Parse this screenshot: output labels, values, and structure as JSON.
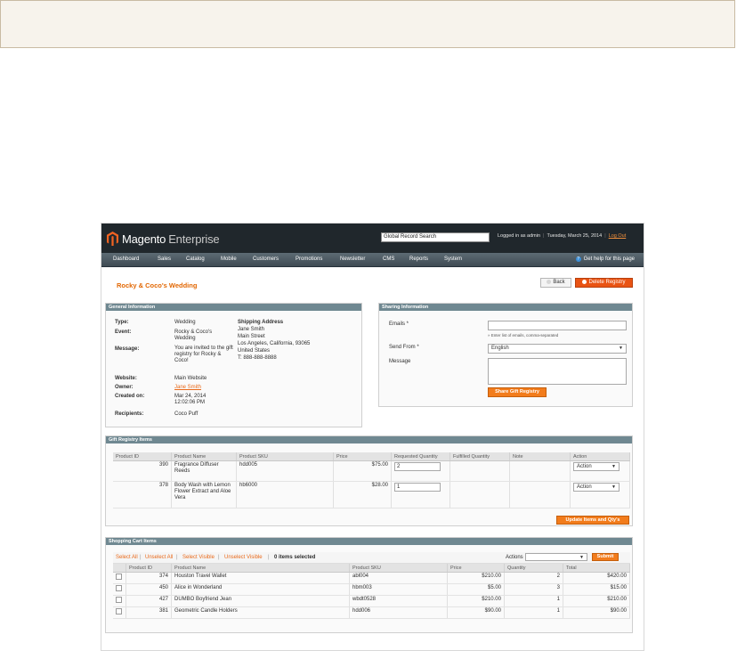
{
  "header": {
    "logo_word": "Magento",
    "logo_edition": "Enterprise",
    "global_search": "Global Record Search",
    "logged_in": "Logged in as admin",
    "date": "Tuesday, March 25, 2014",
    "logout": "Log Out"
  },
  "nav": {
    "items": [
      "Dashboard",
      "Sales",
      "Catalog",
      "Mobile",
      "Customers",
      "Promotions",
      "Newsletter",
      "CMS",
      "Reports",
      "System"
    ],
    "help": "Get help for this page"
  },
  "page": {
    "title": "Rocky & Coco's Wedding",
    "back": "Back",
    "delete": "Delete Registry"
  },
  "general": {
    "heading": "General Information",
    "type_label": "Type:",
    "type": "Wedding",
    "event_label": "Event:",
    "event": "Rocky & Coco's Wedding",
    "message_label": "Message:",
    "message": "You are invited to the gift registry for Rocky & Coco!",
    "website_label": "Website:",
    "website": "Main Website",
    "owner_label": "Owner:",
    "owner": "Jane Smith",
    "created_label": "Created on:",
    "created": "Mar 24, 2014 12:02:06 PM",
    "recipients_label": "Recipients:",
    "recipients": "Coco Puff",
    "shipping_heading": "Shipping Address",
    "shipping_lines": [
      "Jane Smith",
      "Main Street",
      "Los Angeles, California, 93065",
      "United States",
      "T: 888-888-8888"
    ]
  },
  "sharing": {
    "heading": "Sharing Information",
    "emails_label": "Emails *",
    "emails_hint": "Enter list of emails, comma-separated",
    "send_from_label": "Send From *",
    "send_from": "English",
    "message_label": "Message",
    "share_button": "Share Gift Registry"
  },
  "registry_items": {
    "heading": "Gift Registry Items",
    "columns": [
      "Product ID",
      "Product Name",
      "Product SKU",
      "Price",
      "Requested Quantity",
      "Fulfilled Quantity",
      "Note",
      "Action"
    ],
    "rows": [
      {
        "id": "390",
        "name": "Fragrance Diffuser Reeds",
        "sku": "hdd005",
        "price": "$75.00",
        "qty": "2",
        "fulfilled": "",
        "note": "",
        "action": "Action"
      },
      {
        "id": "378",
        "name": "Body Wash with Lemon Flower Extract and Aloe Vera",
        "sku": "hb6000",
        "price": "$28.00",
        "qty": "1",
        "fulfilled": "",
        "note": "",
        "action": "Action"
      }
    ],
    "update_button": "Update Items and Qty's"
  },
  "cart_items": {
    "heading": "Shopping Cart Items",
    "select_all": "Select All",
    "unselect_all": "Unselect All",
    "select_visible": "Select Visible",
    "unselect_visible": "Unselect Visible",
    "selected_count": "0 items selected",
    "actions_label": "Actions",
    "submit": "Submit",
    "columns": [
      "Product ID",
      "Product Name",
      "Product SKU",
      "Price",
      "Quantity",
      "Total"
    ],
    "rows": [
      {
        "id": "374",
        "name": "Houston Travel Wallet",
        "sku": "abl004",
        "price": "$210.00",
        "qty": "2",
        "total": "$420.00"
      },
      {
        "id": "450",
        "name": "Alice in Wonderland",
        "sku": "hbm003",
        "price": "$5.00",
        "qty": "3",
        "total": "$15.00"
      },
      {
        "id": "427",
        "name": "DUMBO Boyfriend Jean",
        "sku": "wbdt0528",
        "price": "$210.00",
        "qty": "1",
        "total": "$210.00"
      },
      {
        "id": "381",
        "name": "Geometric Candle Holders",
        "sku": "hdd006",
        "price": "$90.00",
        "qty": "1",
        "total": "$90.00"
      }
    ]
  },
  "colors": {
    "header_bg": "#20272c",
    "nav_bg": "#4d5a62",
    "accent_orange": "#f27c1c",
    "title_orange": "#e26703",
    "section_head": "#6f8891",
    "note_box_bg": "#f7f3ec"
  }
}
